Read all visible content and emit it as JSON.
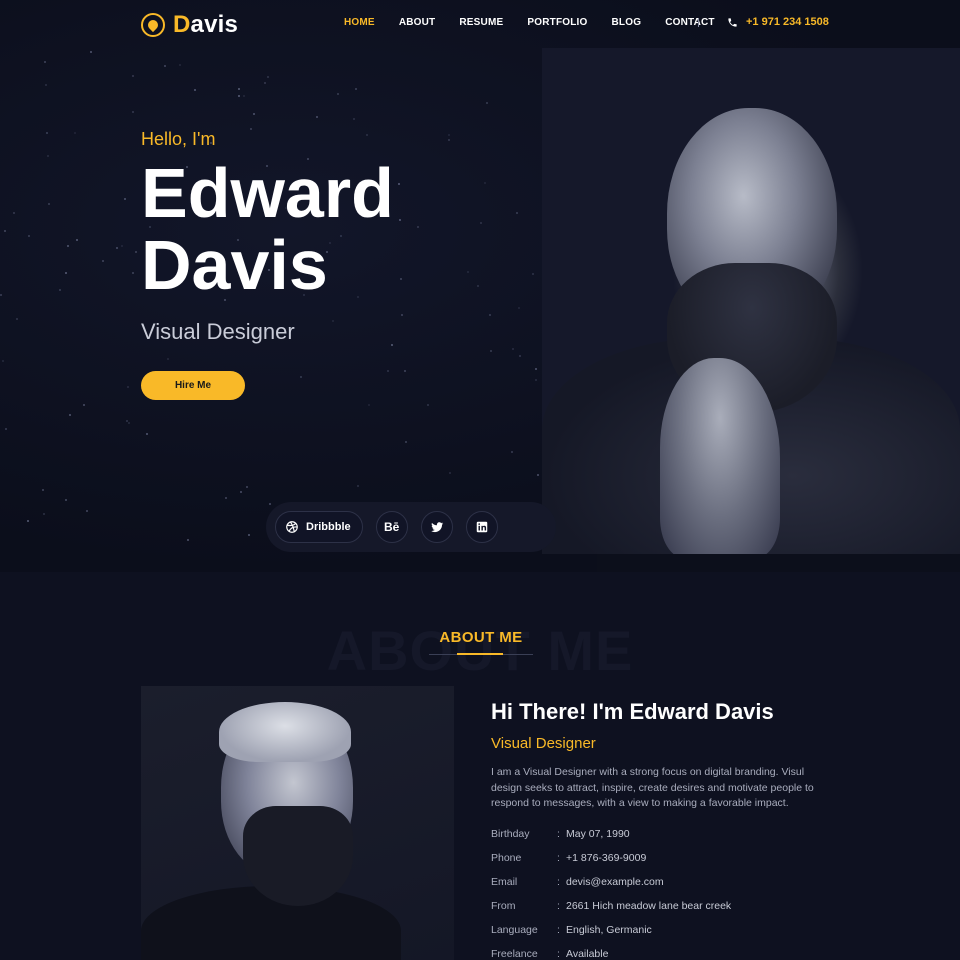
{
  "brand": {
    "first_letter": "D",
    "rest": "avis"
  },
  "nav": {
    "items": [
      {
        "label": "HOME",
        "active": true
      },
      {
        "label": "ABOUT",
        "active": false
      },
      {
        "label": "RESUME",
        "active": false
      },
      {
        "label": "PORTFOLIO",
        "active": false
      },
      {
        "label": "BLOG",
        "active": false
      },
      {
        "label": "CONTACT",
        "active": false
      }
    ],
    "separator": "|",
    "phone": "+1 971 234 1508"
  },
  "hero": {
    "greeting": "Hello, I'm",
    "name_line1": "Edward",
    "name_line2": "Davis",
    "role": "Visual Designer",
    "cta": "Hire Me"
  },
  "social": {
    "dribbble_label": "Dribbble",
    "behance_label": "Bē",
    "icons": [
      "dribbble-icon",
      "behance-icon",
      "twitter-icon",
      "linkedin-icon"
    ]
  },
  "about": {
    "bg_text": "ABOUT ME",
    "section_label": "ABOUT ME",
    "title": "Hi There! I'm Edward Davis",
    "role": "Visual Designer",
    "description": "I am a Visual Designer with a strong focus on digital branding. Visul design seeks to attract, inspire, create desires and motivate people to respond to messages, with a view to making a favorable impact.",
    "info": [
      {
        "key": "Birthday",
        "value": "May 07, 1990"
      },
      {
        "key": "Phone",
        "value": "+1 876-369-9009"
      },
      {
        "key": "Email",
        "value": "devis@example.com"
      },
      {
        "key": "From",
        "value": "2661 Hich meadow lane bear creek"
      },
      {
        "key": "Language",
        "value": "English, Germanic"
      },
      {
        "key": "Freelance",
        "value": "Available"
      }
    ],
    "separator": ":"
  },
  "colors": {
    "accent": "#f9b928",
    "background": "#0e1120",
    "text": "#ffffff",
    "muted": "#a9adbd"
  }
}
